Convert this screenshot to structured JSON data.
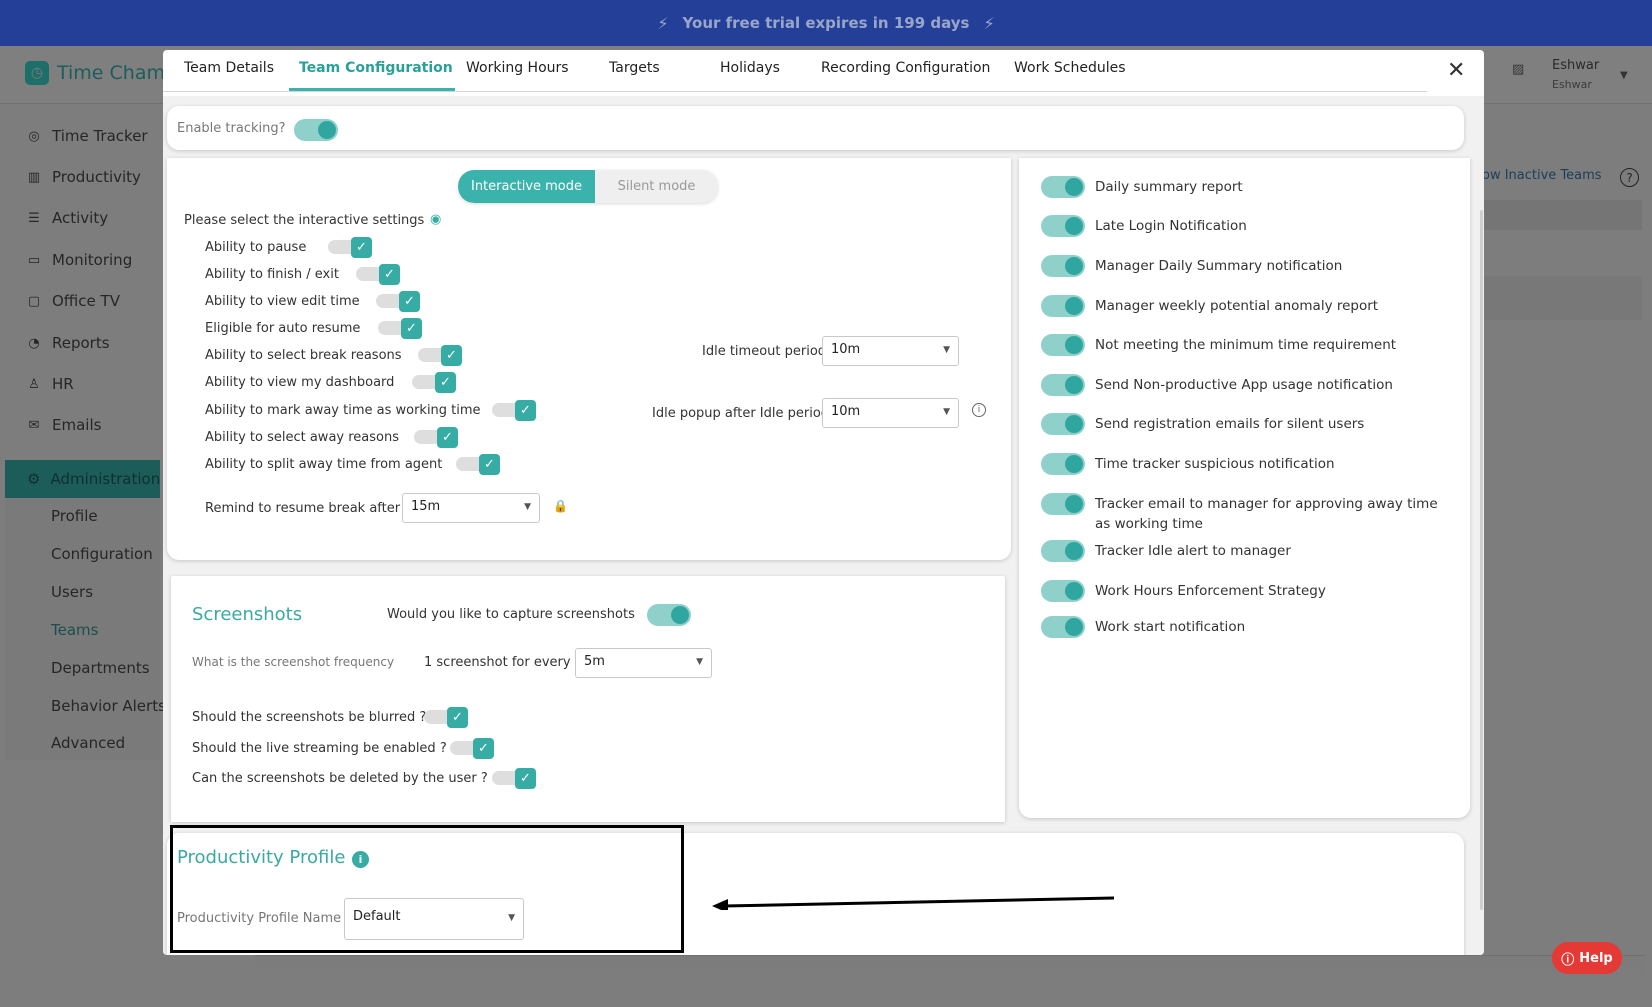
{
  "banner": {
    "text": "Your free trial expires in 199 days"
  },
  "app": {
    "name": "Time Champ"
  },
  "user": {
    "name": "Eshwar",
    "sub": "Eshwar"
  },
  "sidebar": {
    "items": [
      {
        "label": "Time Tracker",
        "icon": "timer-icon"
      },
      {
        "label": "Productivity",
        "icon": "chart-icon"
      },
      {
        "label": "Activity",
        "icon": "list-icon"
      },
      {
        "label": "Monitoring",
        "icon": "monitor-icon"
      },
      {
        "label": "Office TV",
        "icon": "tv-icon"
      },
      {
        "label": "Reports",
        "icon": "reports-icon"
      },
      {
        "label": "HR",
        "icon": "person-icon"
      },
      {
        "label": "Emails",
        "icon": "mail-icon"
      }
    ],
    "admin_label": "Administration",
    "sub_items": [
      "Profile",
      "Configuration",
      "Users",
      "Teams",
      "Departments",
      "Behavior Alerts",
      "Advanced"
    ],
    "active_sub": "Teams"
  },
  "background": {
    "inactive_teams_link": "ow Inactive Teams"
  },
  "modal": {
    "tabs": [
      "Team Details",
      "Team Configuration",
      "Working Hours",
      "Targets",
      "Holidays",
      "Recording Configuration",
      "Work Schedules"
    ],
    "active_tab": "Team Configuration",
    "enable_tracking": {
      "label": "Enable tracking?",
      "value": true
    },
    "mode": {
      "interactive": "Interactive mode",
      "silent": "Silent mode",
      "selected": "Interactive mode"
    },
    "interactive_settings_label": "Please select the interactive settings",
    "interactive_settings": [
      {
        "label": "Ability to pause",
        "checked": true
      },
      {
        "label": "Ability to finish / exit",
        "checked": true
      },
      {
        "label": "Ability to view edit time",
        "checked": true
      },
      {
        "label": "Eligible for auto resume",
        "checked": true
      },
      {
        "label": "Ability to select break reasons",
        "checked": true
      },
      {
        "label": "Ability to view my dashboard",
        "checked": true
      },
      {
        "label": "Ability to mark away time as working time",
        "checked": true
      },
      {
        "label": "Ability to select away reasons",
        "checked": true
      },
      {
        "label": "Ability to split away time from agent",
        "checked": true
      }
    ],
    "idle_timeout": {
      "label": "Idle timeout period",
      "value": "10m"
    },
    "idle_popup": {
      "label": "Idle popup after Idle period",
      "value": "10m"
    },
    "remind_resume": {
      "label": "Remind to resume break after",
      "value": "15m"
    },
    "screenshots": {
      "title": "Screenshots",
      "capture_label": "Would you like to capture screenshots",
      "capture": true,
      "frequency_label": "What is the screenshot frequency",
      "frequency_prefix": "1 screenshot for every",
      "frequency_value": "5m",
      "options": [
        {
          "label": "Should the screenshots be blurred ?",
          "checked": true
        },
        {
          "label": "Should the live streaming be enabled ?",
          "checked": true
        },
        {
          "label": "Can the screenshots be deleted by the user ?",
          "checked": true
        }
      ]
    },
    "notifications": [
      {
        "label": "Daily summary report",
        "on": true
      },
      {
        "label": "Late Login Notification",
        "on": true
      },
      {
        "label": "Manager Daily Summary notification",
        "on": true
      },
      {
        "label": "Manager weekly potential anomaly report",
        "on": true
      },
      {
        "label": "Not meeting the minimum time requirement",
        "on": true
      },
      {
        "label": "Send Non-productive App usage notification",
        "on": true
      },
      {
        "label": "Send registration emails for silent users",
        "on": true
      },
      {
        "label": "Time tracker suspicious notification",
        "on": true
      },
      {
        "label": "Tracker email to manager for approving away time as working time",
        "on": true
      },
      {
        "label": "Tracker Idle alert to manager",
        "on": true
      },
      {
        "label": "Work Hours Enforcement Strategy",
        "on": true
      },
      {
        "label": "Work start notification",
        "on": true
      }
    ],
    "productivity_profile": {
      "title": "Productivity Profile",
      "name_label": "Productivity Profile Name",
      "required_mark": "*",
      "colon": ":",
      "value": "Default"
    }
  },
  "help": {
    "label": "Help"
  },
  "colors": {
    "accent": "#3bb3ad",
    "banner": "#233f97",
    "help": "#e53935"
  }
}
